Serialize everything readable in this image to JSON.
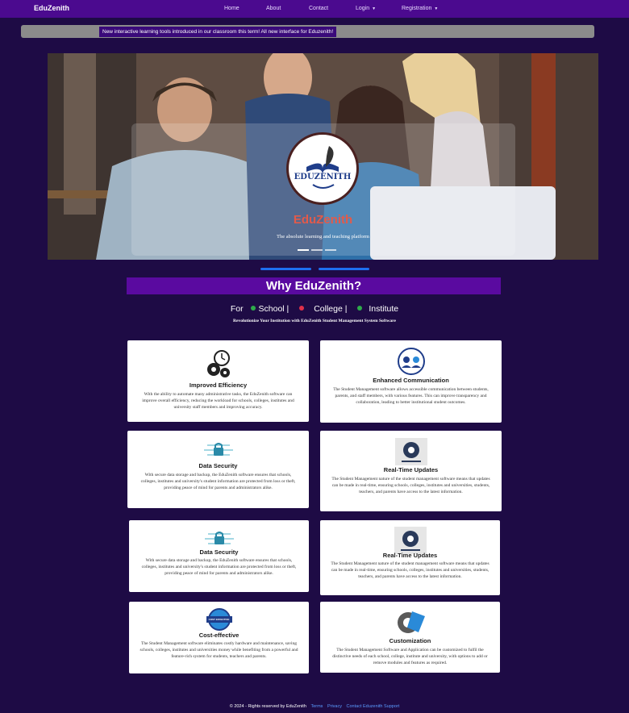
{
  "nav": {
    "brand": "EduZenith",
    "links": [
      "Home",
      "About",
      "Contact",
      "Login",
      "Registration"
    ]
  },
  "ticker": "New interactive learning tools introduced in our classroom this term! All new interface for Eduzenith!",
  "hero": {
    "logo_text": "EDUZENITH",
    "title": "EduZenith",
    "subtitle": "The absolute learning and teaching platform"
  },
  "why": {
    "title": "Why EduZenith?",
    "for_label": "For",
    "institutions": [
      "School |",
      "College |",
      "Institute"
    ],
    "tagline": "Revolutionize Your Institution with EduZenith Student Management System Software"
  },
  "cards": [
    {
      "title": "Improved Efficiency",
      "icon": "gears-clock-icon",
      "text": "With the ability to automate many administrative tasks, the EduZenith software can improve overall efficiency, reducing the workload for schools, colleges, institutes and university staff members and improving accuracy."
    },
    {
      "title": "Enhanced Communication",
      "icon": "communication-icon",
      "text": "The Student Management software allows accessible communication between students, parents, and staff members, with various features. This can improve transparency and collaboration, leading to better institutional student outcomes."
    },
    {
      "title": "Data Security",
      "icon": "lock-circuit-icon",
      "text": "With secure data storage and backup, the EduZenith software ensures that schools, colleges, institutes and university's student information are protected from loss or theft, providing peace of mind for parents and administrators alike."
    },
    {
      "title": "Real-Time Updates",
      "icon": "update-gear-icon",
      "text": "The Student Management nature of the student management software means that updates can be made in real-time, ensuring schools, colleges, institutes and universities, students, teachers, and parents have access to the latest information."
    },
    {
      "title": "Data Security",
      "icon": "lock-circuit-icon",
      "text": "With secure data storage and backup, the EduZenith software ensures that schools, colleges, institutes and university's student information are protected from loss or theft, providing peace of mind for parents and administrators alike."
    },
    {
      "title": "Real-Time Updates",
      "icon": "update-gear-icon",
      "text": "The Student Management nature of the student management software means that updates can be made in real-time, ensuring schools, colleges, institutes and universities, students, teachers, and parents have access to the latest information."
    },
    {
      "title": "Cost-effective",
      "icon": "cost-effective-badge-icon",
      "badge_text": "COST EFFECTIVE",
      "text": "The Student Management software eliminates costly hardware and maintenance, saving schools, colleges, institutes and universities money while benefiting from a powerful and feature-rich system for students, teachers and parents."
    },
    {
      "title": "Customization",
      "icon": "customization-gear-icon",
      "text": "The Student Management Software and Application can be customized to fulfil the distinctive needs of each school, college, institute and university, with options to add or remove modules and features as required."
    }
  ],
  "footer": {
    "copyright": "© 2024 - Rights reserved by EduZenith",
    "links": [
      "Terms",
      "Privacy",
      "Contact Eduzenith Support"
    ]
  },
  "colors": {
    "page_bg": "#1e0b45",
    "navbar": "#4b0a8f",
    "banner": "#5a0aa0",
    "accent_blue": "#1e6ff0",
    "hero_title": "#e35a4a",
    "bullet_green": "#2eaa4a",
    "bullet_red": "#e0304a"
  }
}
